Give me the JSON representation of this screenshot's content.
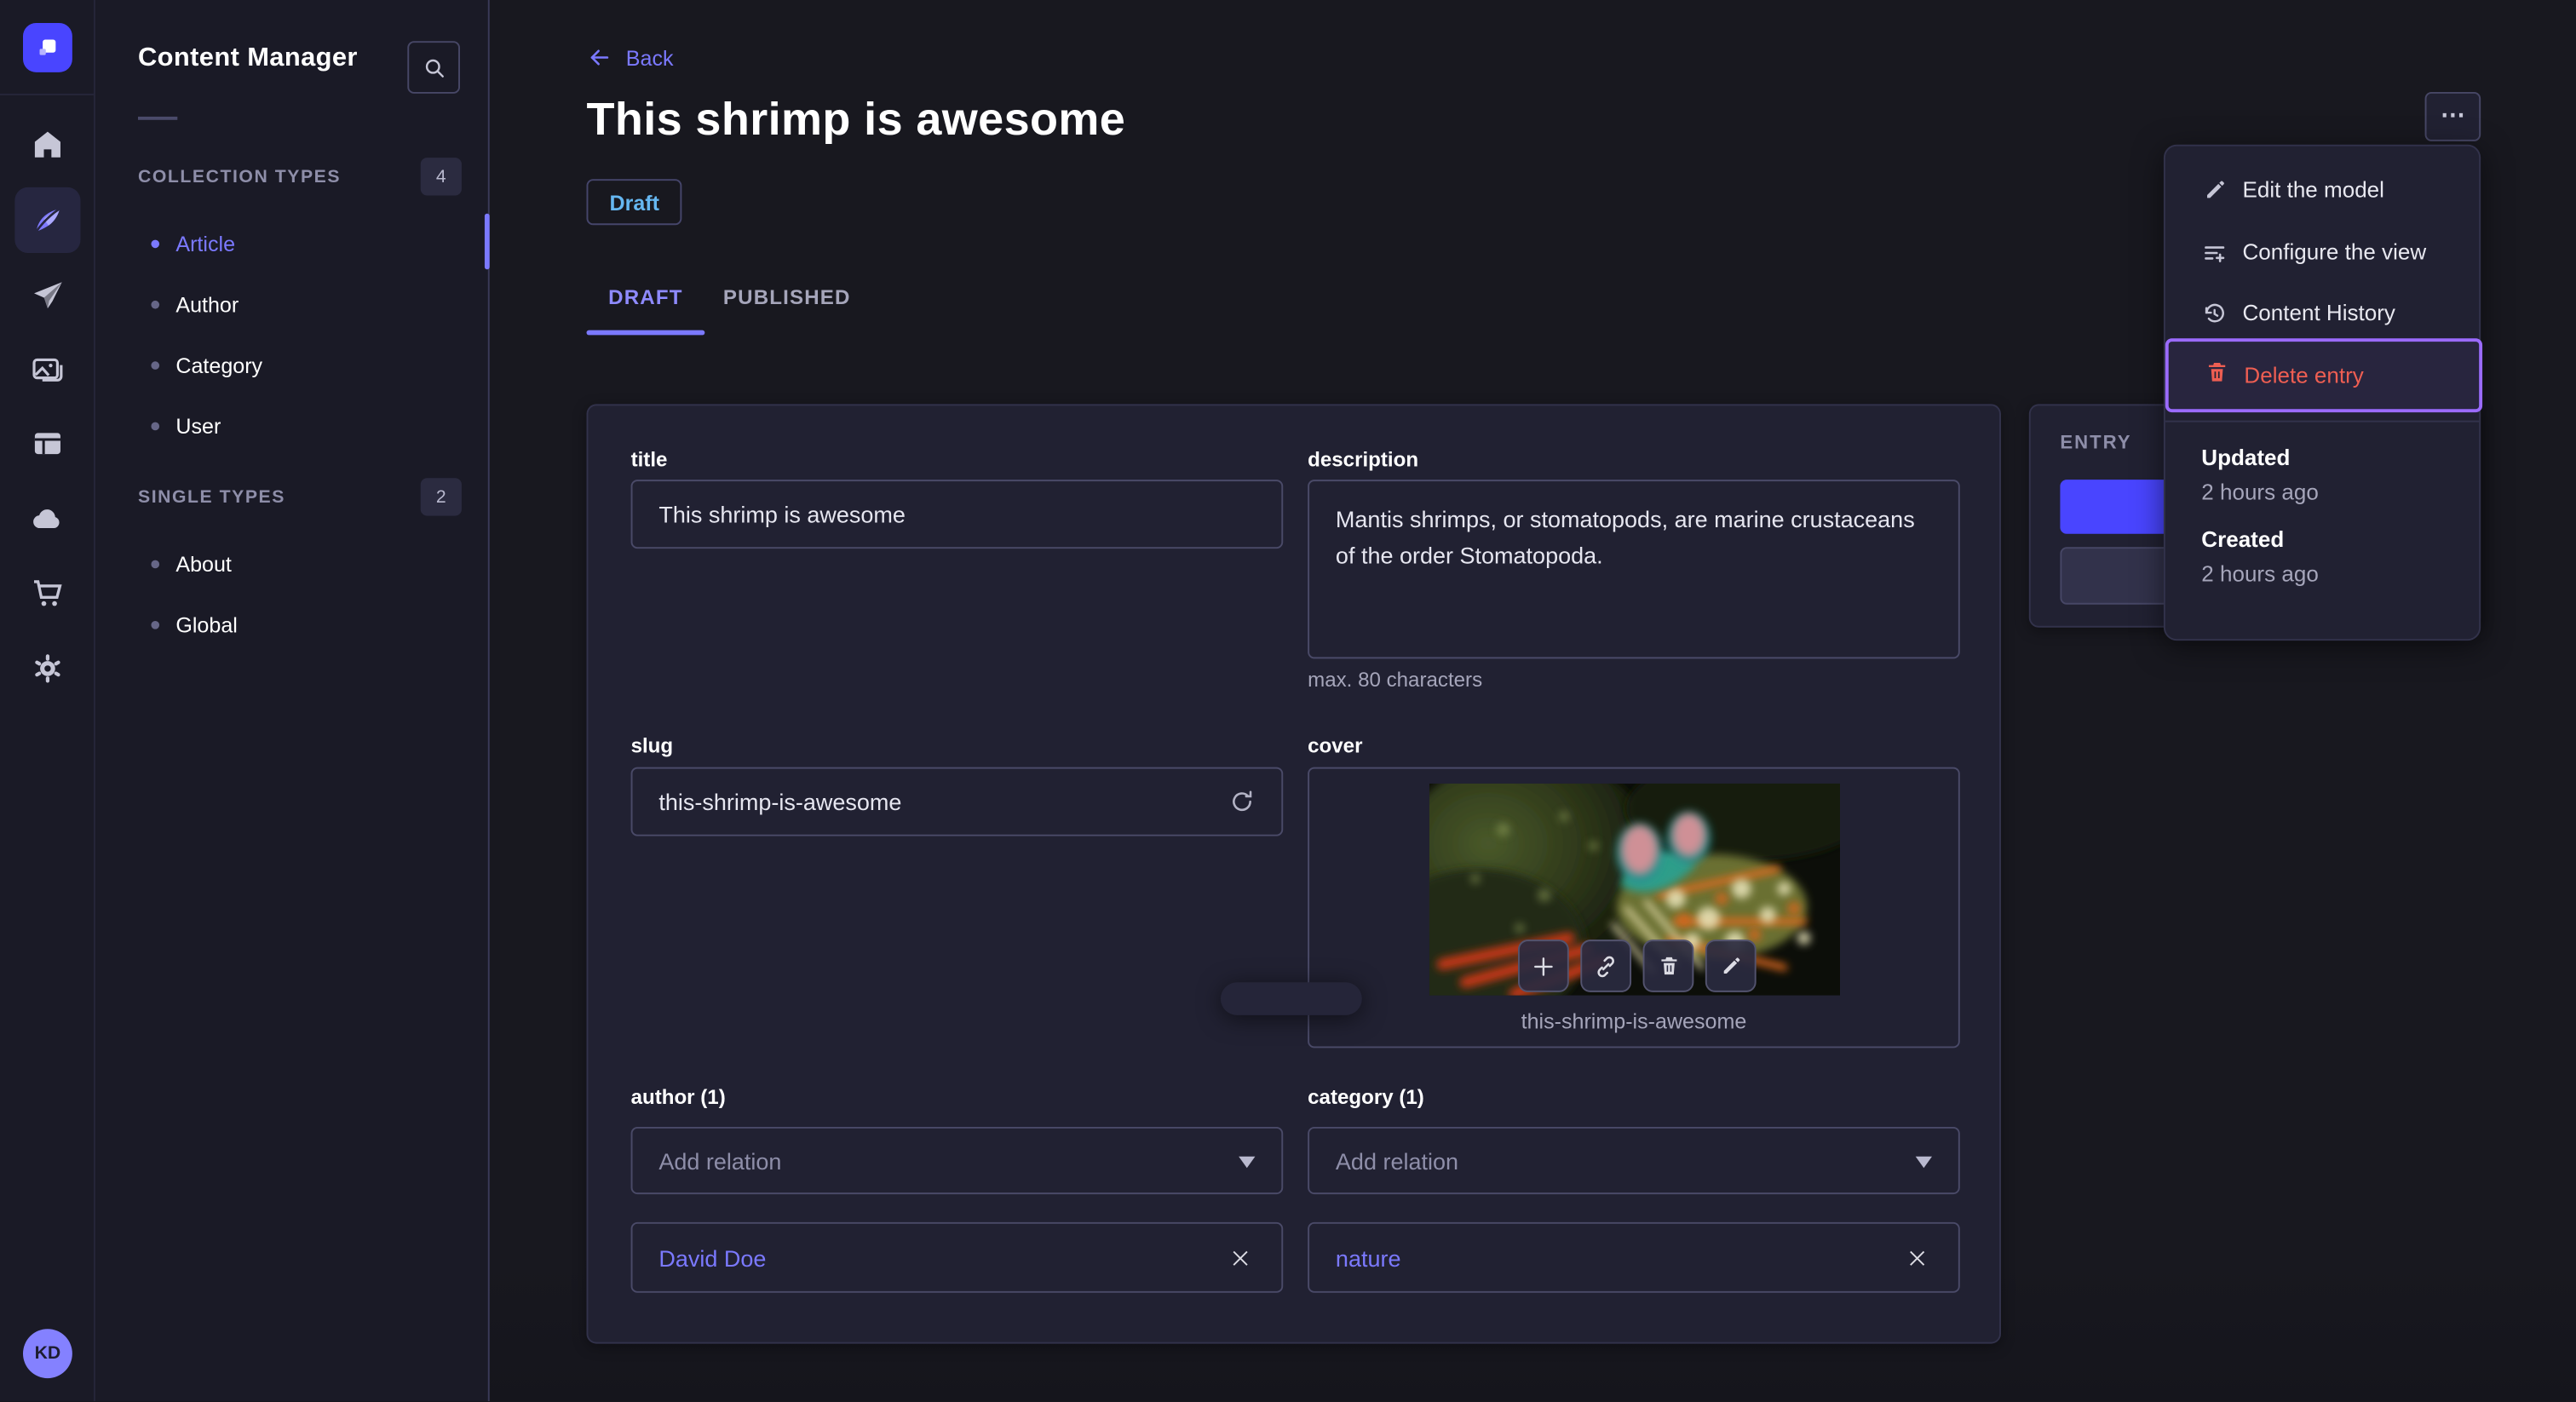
{
  "sidebar": {
    "avatar_initials": "KD",
    "icons": [
      "strapi-logo",
      "home-icon",
      "feather-icon",
      "send-icon",
      "media-icon",
      "layout-icon",
      "cloud-icon",
      "cart-icon",
      "gear-icon"
    ]
  },
  "subnav": {
    "title": "Content Manager",
    "search_icon": "search-icon",
    "sections": [
      {
        "label": "COLLECTION TYPES",
        "count": "4",
        "items": [
          {
            "label": "Article"
          },
          {
            "label": "Author"
          },
          {
            "label": "Category"
          },
          {
            "label": "User"
          }
        ]
      },
      {
        "label": "SINGLE TYPES",
        "count": "2",
        "items": [
          {
            "label": "About"
          },
          {
            "label": "Global"
          }
        ]
      }
    ]
  },
  "header": {
    "back_label": "Back",
    "title": "This shrimp is awesome",
    "status": "Draft",
    "tabs": [
      {
        "label": "DRAFT"
      },
      {
        "label": "PUBLISHED"
      }
    ],
    "more_label": "⋯"
  },
  "menu": {
    "items": [
      {
        "label": "Edit the model",
        "icon": "pencil-icon"
      },
      {
        "label": "Configure the view",
        "icon": "configure-icon"
      },
      {
        "label": "Content History",
        "icon": "history-icon"
      },
      {
        "label": "Delete entry",
        "icon": "trash-icon",
        "danger": true,
        "highlighted": true
      }
    ],
    "meta": [
      {
        "label": "Updated",
        "value": "2 hours ago"
      },
      {
        "label": "Created",
        "value": "2 hours ago"
      }
    ]
  },
  "entry_panel": {
    "label": "ENTRY"
  },
  "form": {
    "title": {
      "label": "title",
      "value": "This shrimp is awesome"
    },
    "description": {
      "label": "description",
      "value": "Mantis shrimps, or stomatopods, are marine crustaceans of the order Stomatopoda.",
      "hint": "max. 80 characters"
    },
    "slug": {
      "label": "slug",
      "value": "this-shrimp-is-awesome"
    },
    "cover": {
      "label": "cover",
      "caption": "this-shrimp-is-awesome"
    },
    "author": {
      "label": "author (1)",
      "placeholder": "Add relation",
      "relation": "David Doe"
    },
    "category": {
      "label": "category (1)",
      "placeholder": "Add relation",
      "relation": "nature"
    }
  },
  "colors": {
    "accent": "#4945ff",
    "link": "#7b79ff",
    "danger": "#ee5e52",
    "draft_badge": "#66b7f1",
    "highlight_border": "#9b6bff"
  }
}
